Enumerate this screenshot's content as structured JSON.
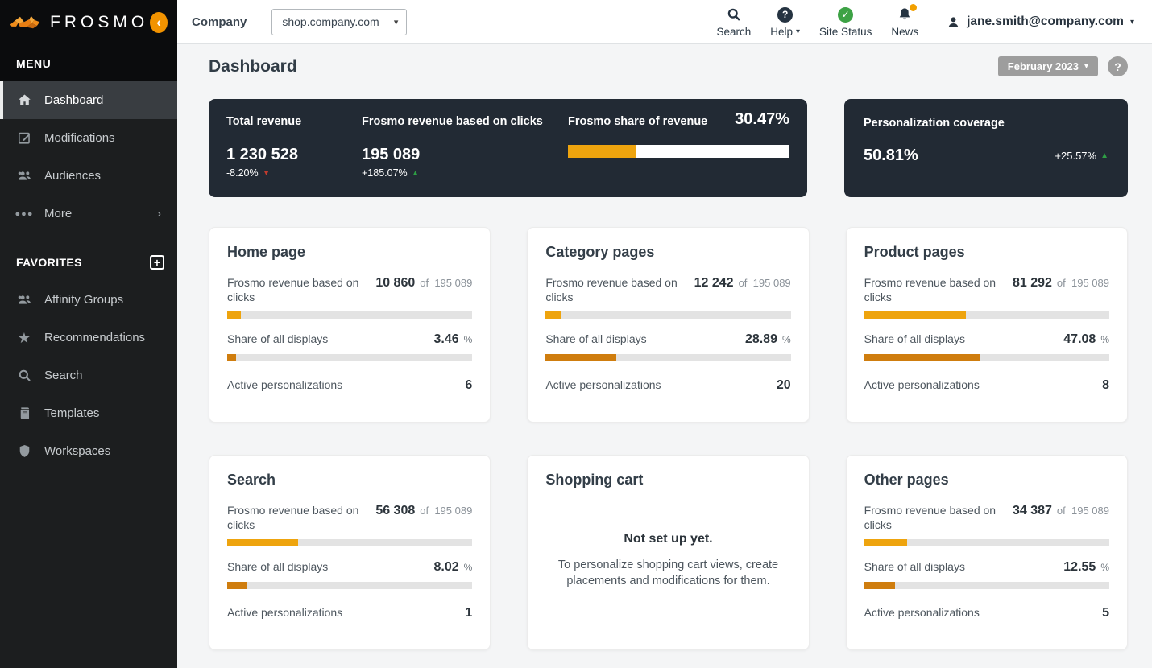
{
  "brand": {
    "name": "FROSMO"
  },
  "icons": {
    "chevron_left": "‹",
    "chevron_right": "›",
    "caret_down": "▾",
    "plus": "+",
    "check": "✓",
    "question": "?",
    "ellipsis": "●●●",
    "star": "★",
    "tri_up": "▲",
    "tri_down": "▼"
  },
  "colors": {
    "brand_orange": "#f29300",
    "bar_amber": "#eea40e",
    "bar_amber_dark": "#cf7d0e",
    "dark_card_bg": "#222a34",
    "positive_green": "#2e9e44",
    "negative_red": "#c23b2e"
  },
  "sidebar": {
    "menu_title": "MENU",
    "menu_items": [
      {
        "label": "Dashboard"
      },
      {
        "label": "Modifications"
      },
      {
        "label": "Audiences"
      },
      {
        "label": "More"
      }
    ],
    "favorites_title": "FAVORITES",
    "favorites_items": [
      {
        "label": "Affinity Groups"
      },
      {
        "label": "Recommendations"
      },
      {
        "label": "Search"
      },
      {
        "label": "Templates"
      },
      {
        "label": "Workspaces"
      }
    ]
  },
  "topbar": {
    "company_label": "Company",
    "site_selector_value": "shop.company.com",
    "search_label": "Search",
    "help_label": "Help",
    "site_status_label": "Site Status",
    "news_label": "News",
    "user_email": "jane.smith@company.com"
  },
  "header": {
    "title": "Dashboard",
    "period": "February 2023"
  },
  "summary": {
    "total_revenue": {
      "label": "Total revenue",
      "value": "1 230 528",
      "change": "-8.20%"
    },
    "frosmo_revenue": {
      "label": "Frosmo revenue based on clicks",
      "value": "195 089",
      "change": "+185.07%"
    },
    "share_of_revenue": {
      "label": "Frosmo share of revenue",
      "value": "30.47%",
      "fill_pct": 30.47
    },
    "coverage": {
      "label": "Personalization coverage",
      "value": "50.81%",
      "change": "+25.57%"
    }
  },
  "page_cards": {
    "revenue_label": "Frosmo revenue based on clicks",
    "of_label": "of",
    "total": "195 089",
    "share_label": "Share of all displays",
    "percent_sign": "%",
    "active_label": "Active personalizations",
    "cards": [
      {
        "title": "Home page",
        "revenue": "10 860",
        "revenue_pct": 5.57,
        "share": "3.46",
        "share_pct": 3.46,
        "active": "6"
      },
      {
        "title": "Category pages",
        "revenue": "12 242",
        "revenue_pct": 6.28,
        "share": "28.89",
        "share_pct": 28.89,
        "active": "20"
      },
      {
        "title": "Product pages",
        "revenue": "81 292",
        "revenue_pct": 41.67,
        "share": "47.08",
        "share_pct": 47.08,
        "active": "8"
      },
      {
        "title": "Search",
        "revenue": "56 308",
        "revenue_pct": 28.86,
        "share": "8.02",
        "share_pct": 8.02,
        "active": "1"
      },
      {
        "title": "Other pages",
        "revenue": "34 387",
        "revenue_pct": 17.63,
        "share": "12.55",
        "share_pct": 12.55,
        "active": "5"
      }
    ],
    "empty_card": {
      "title": "Shopping cart",
      "headline": "Not set up yet.",
      "message": "To personalize shopping cart views, create placements and modifications for them."
    }
  }
}
